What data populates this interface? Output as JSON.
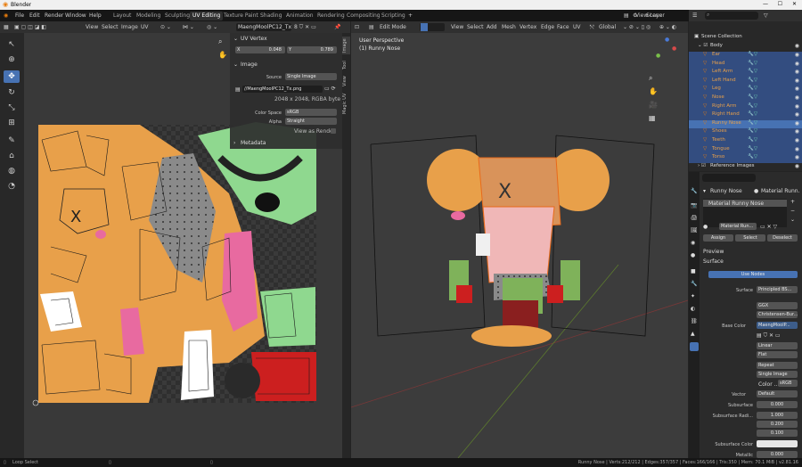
{
  "title": "Blender",
  "menus": [
    "File",
    "Edit",
    "Render",
    "Window",
    "Help"
  ],
  "workspaces": [
    "Layout",
    "Modeling",
    "Sculpting",
    "UV Editing",
    "Texture Paint",
    "Shading",
    "Animation",
    "Rendering",
    "Compositing",
    "Scripting"
  ],
  "active_workspace": "UV Editing",
  "scene_label": "Scene",
  "view_layer_label": "View Layer",
  "uv_header": {
    "view": "View",
    "select": "Select",
    "image": "Image",
    "uv": "UV",
    "image_name": "MaengMoolPC12_Tx..."
  },
  "viewport_header": {
    "mode": "Edit Mode",
    "view": "View",
    "select": "Select",
    "add": "Add",
    "mesh": "Mesh",
    "vertex": "Vertex",
    "edge": "Edge",
    "face": "Face",
    "uv": "UV",
    "orientation": "Global"
  },
  "viewport_overlay": {
    "perspective": "User Perspective",
    "object": "(1) Runny Nose"
  },
  "npanel": {
    "uv_vertex_title": "UV Vertex",
    "x_label": "X",
    "x_value": "0.048",
    "y_label": "Y",
    "y_value": "0.789",
    "image_title": "Image",
    "source_label": "Source",
    "source_value": "Single Image",
    "path": "//MaengMoolPC12_Tx.png",
    "resolution": "2048 x 2048,  RGBA byte",
    "color_space_label": "Color Space",
    "color_space_value": "sRGB",
    "alpha_label": "Alpha",
    "alpha_value": "Straight",
    "view_as_render": "View as Render",
    "metadata_title": "Metadata"
  },
  "side_tabs": [
    "Image",
    "Tool",
    "View",
    "Magic UV"
  ],
  "outliner": {
    "collection": "Scene Collection",
    "body": "Body",
    "items": [
      "Ear",
      "Head",
      "Left Arm",
      "Left Hand",
      "Leg",
      "Nose",
      "Right Arm",
      "Right Hand",
      "Runny Nose",
      "Shoes",
      "Teeth",
      "Tongue",
      "Torso"
    ],
    "active_item": "Runny Nose",
    "reference": "Reference Images"
  },
  "properties": {
    "object_name": "Runny Nose",
    "material_name": "Material Runn...",
    "slot_name": "Material Runny Nose",
    "material_field": "Material Run...",
    "assign": "Assign",
    "select": "Select",
    "deselect": "Deselect",
    "preview": "Preview",
    "surface_panel": "Surface",
    "use_nodes": "Use Nodes",
    "surface_label": "Surface",
    "surface_value": "Principled BS...",
    "distribution": "GGX",
    "subsurface_method": "Christensen-Bur...",
    "base_color_label": "Base Color",
    "base_color_value": "MaengMoolP...",
    "interp": "Linear",
    "projection": "Flat",
    "extension": "Repeat",
    "source": "Single Image",
    "color_label": "Color ...",
    "color_space": "sRGB",
    "vector_label": "Vector",
    "vector_value": "Default",
    "subsurface_label": "Subsurface",
    "subsurface_value": "0.000",
    "radius_label": "Subsurface Radi...",
    "radius_values": [
      "1.000",
      "0.200",
      "0.100"
    ],
    "subsurface_color_label": "Subsurface Color",
    "metallic_label": "Metallic",
    "metallic_value": "0.000"
  },
  "status": {
    "left": "Loop Select",
    "right": "Runny Nose | Verts:212/212 | Edges:357/357 | Faces:166/166 | Tris:350 | Mem: 70.1 MiB | v2.81.16"
  },
  "colors": {
    "accent": "#4772b3",
    "orange": "#e8a04a",
    "green": "#8fd88f",
    "pink": "#e86aa0",
    "red": "#cc1f1f",
    "gray": "#8a8a8a"
  }
}
